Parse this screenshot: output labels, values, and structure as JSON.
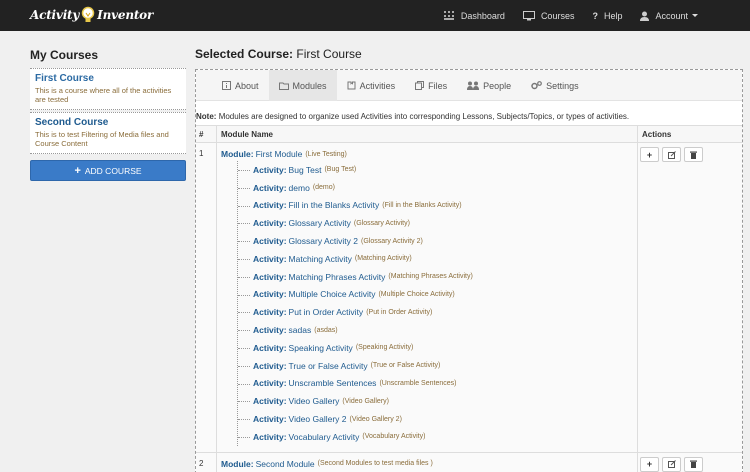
{
  "brand": {
    "left": "Activity",
    "right": "Inventor"
  },
  "nav": {
    "dashboard": "Dashboard",
    "courses": "Courses",
    "help": "Help",
    "account": "Account"
  },
  "sidebar": {
    "title": "My Courses",
    "courses": [
      {
        "title": "First Course",
        "description": "This is a course where all of the activities are tested"
      },
      {
        "title": "Second Course",
        "description": "This is to test Filtering of Media files and Course Content"
      }
    ],
    "add_course": "ADD COURSE"
  },
  "main": {
    "selected_label": "Selected Course:",
    "selected_name": "First Course",
    "tabs": [
      "About",
      "Modules",
      "Activities",
      "Files",
      "People",
      "Settings"
    ],
    "note_label": "Note:",
    "note_text": "Modules are designed to organize used Activities into corresponding Lessons, Subjects/Topics, or types of activities.",
    "headers": {
      "num": "#",
      "name": "Module Name",
      "actions": "Actions"
    },
    "module_label": "Module:",
    "activity_label": "Activity:",
    "modules": [
      {
        "num": "1",
        "name": "First Module",
        "sub": "(Live Testing)",
        "activities": [
          {
            "name": "Bug Test",
            "sub": "(Bug Test)"
          },
          {
            "name": "demo",
            "sub": "(demo)"
          },
          {
            "name": "Fill in the Blanks Activity",
            "sub": "(Fill in the Blanks Activity)"
          },
          {
            "name": "Glossary Activity",
            "sub": "(Glossary Activity)"
          },
          {
            "name": "Glossary Activity 2",
            "sub": "(Glossary Activity 2)"
          },
          {
            "name": "Matching Activity",
            "sub": "(Matching Activity)"
          },
          {
            "name": "Matching Phrases Activity",
            "sub": "(Matching Phrases Activity)"
          },
          {
            "name": "Multiple Choice Activity",
            "sub": "(Multiple Choice Activity)"
          },
          {
            "name": "Put in Order Activity",
            "sub": "(Put in Order Activity)"
          },
          {
            "name": "sadas",
            "sub": "(asdas)"
          },
          {
            "name": "Speaking Activity",
            "sub": "(Speaking Activity)"
          },
          {
            "name": "True or False Activity",
            "sub": "(True or False Activity)"
          },
          {
            "name": "Unscramble Sentences",
            "sub": "(Unscramble Sentences)"
          },
          {
            "name": "Video Gallery",
            "sub": "(Video Gallery)"
          },
          {
            "name": "Video Gallery 2",
            "sub": "(Video Gallery 2)"
          },
          {
            "name": "Vocabulary Activity",
            "sub": "(Vocabulary Activity)"
          }
        ]
      },
      {
        "num": "2",
        "name": "Second Module",
        "sub": "(Second Modules to test media files )",
        "activities": []
      }
    ]
  },
  "colors": {
    "navbar": "#222222",
    "link": "#1f5b8f",
    "sub": "#8a6d3b",
    "button": "#3a7bc8"
  },
  "icons": [
    "bulb-logo-icon",
    "dashboard-icon",
    "monitor-icon",
    "question-icon",
    "user-icon",
    "info-icon",
    "folder-icon",
    "puzzle-icon",
    "files-icon",
    "people-icon",
    "gears-icon",
    "plus-icon",
    "edit-icon",
    "trash-icon"
  ]
}
